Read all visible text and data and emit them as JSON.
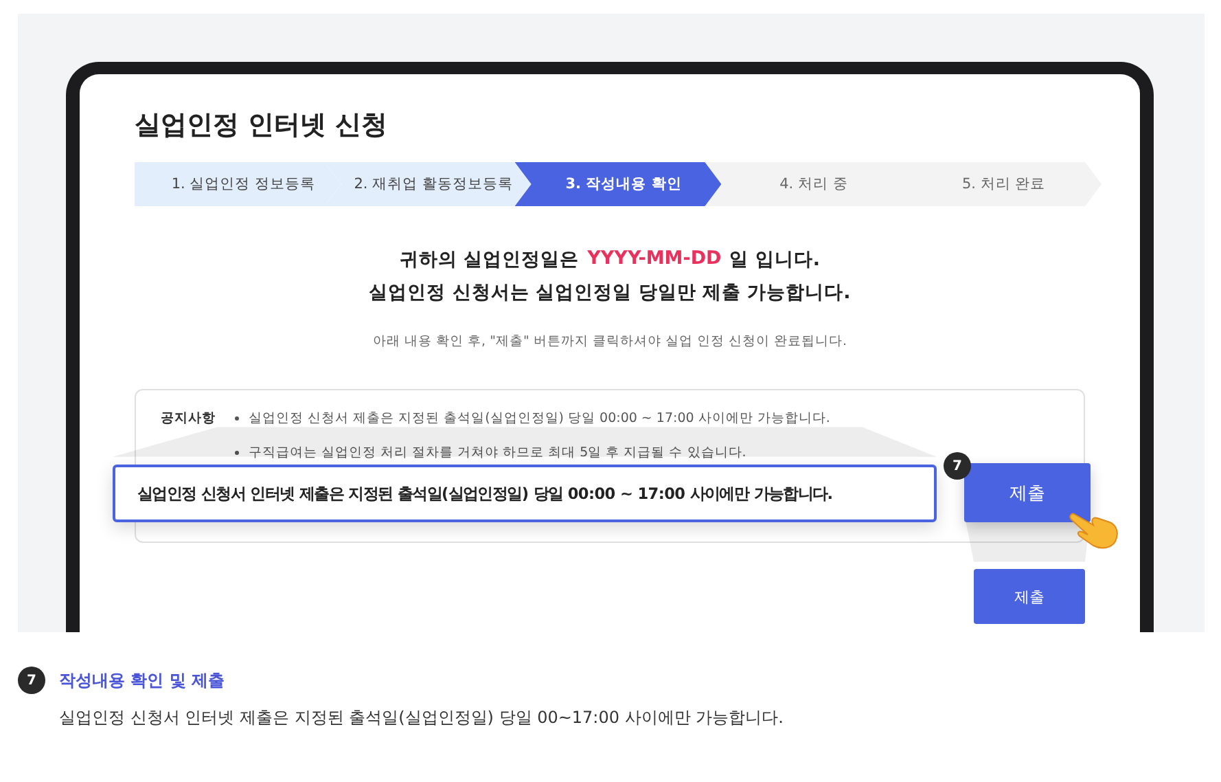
{
  "screen": {
    "title": "실업인정 인터넷 신청",
    "steps": [
      {
        "label": "1. 실업인정 정보등록",
        "completed": true,
        "selected": false
      },
      {
        "label": "2. 재취업 활동정보등록",
        "completed": true,
        "selected": false
      },
      {
        "label": "3. 작성내용 확인",
        "completed": false,
        "selected": true
      },
      {
        "label": "4. 처리 중",
        "completed": false,
        "selected": false
      },
      {
        "label": "5. 처리 완료",
        "completed": false,
        "selected": false
      }
    ],
    "date_line": {
      "before": "귀하의 실업인정일은",
      "date": "YYYY-MM-DD",
      "after": "일 입니다."
    },
    "submit_rule": "실업인정 신청서는 실업인정일 당일만 제출 가능합니다.",
    "hint": "아래 내용 확인 후, \"제출\" 버튼까지 클릭하셔야 실업 인정 신청이 완료됩니다.",
    "notice": {
      "label": "공지사항",
      "items": [
        "실업인정 신청서 제출은 지정된 출석일(실업인정일) 당일 00:00 ~ 17:00 사이에만 가능합니다.",
        "구직급여는 실업인정 처리 절차를 거쳐야 하므로 최대 5일 후 지급될 수 있습니다."
      ]
    },
    "submit_button": "제출"
  },
  "callout": {
    "text": "실업인정 신청서 인터넷 제출은 지정된 출석일(실업인정일) 당일 00:00 ~ 17:00 사이에만 가능합니다.",
    "badge": "7",
    "button": "제출"
  },
  "caption": {
    "badge": "7",
    "title": "작성내용 확인 및 제출",
    "text": "실업인정 신청서 인터넷 제출은 지정된 출석일(실업인정일) 당일 00~17:00 사이에만 가능합니다."
  }
}
